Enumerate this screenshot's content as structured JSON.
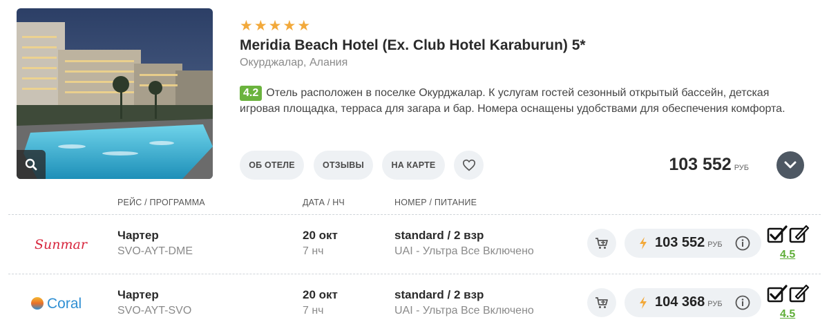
{
  "hotel": {
    "stars": 5,
    "name": "Meridia Beach Hotel (Ex. Club Hotel Karaburun) 5*",
    "location": "Окурджалар, Алания",
    "rating": "4.2",
    "description": "Отель расположен в поселке Окурджалар. К услугам гостей сезонный открытый бассейн, детская игровая площадка, терраса для загара и бар. Номера оснащены удобствами для обеспечения комфорта."
  },
  "actions": {
    "about": "ОБ ОТЕЛЕ",
    "reviews": "ОТЗЫВЫ",
    "map": "НА КАРТЕ",
    "favorite_icon": "heart-outline-icon"
  },
  "price_summary": {
    "amount": "103 552",
    "currency": "РУБ"
  },
  "columns": {
    "flight": "РЕЙС / ПРОГРАММА",
    "date": "ДАТА / НЧ",
    "room": "НОМЕР / ПИТАНИЕ"
  },
  "offers": [
    {
      "operator": "Sunmar",
      "flight_type": "Чартер",
      "route": "SVO-AYT-DME",
      "date": "20 окт",
      "nights": "7 нч",
      "room": "standard / 2 взр",
      "meal": "UAI - Ультра Все Включено",
      "price": "103 552",
      "currency": "РУБ",
      "score": "4.5"
    },
    {
      "operator": "Coral",
      "flight_type": "Чартер",
      "route": "SVO-AYT-SVO",
      "date": "20 окт",
      "nights": "7 нч",
      "room": "standard / 2 взр",
      "meal": "UAI - Ультра Все Включено",
      "price": "104 368",
      "currency": "РУБ",
      "score": "4.5"
    }
  ],
  "colors": {
    "star": "#f2a93b",
    "rating_badge": "#6bb33e",
    "score_link": "#5fae38",
    "pill_bg": "#eef1f4",
    "expand_btn": "#4e5863",
    "sunmar_red": "#d7263d",
    "coral_blue": "#2f8fd3"
  }
}
